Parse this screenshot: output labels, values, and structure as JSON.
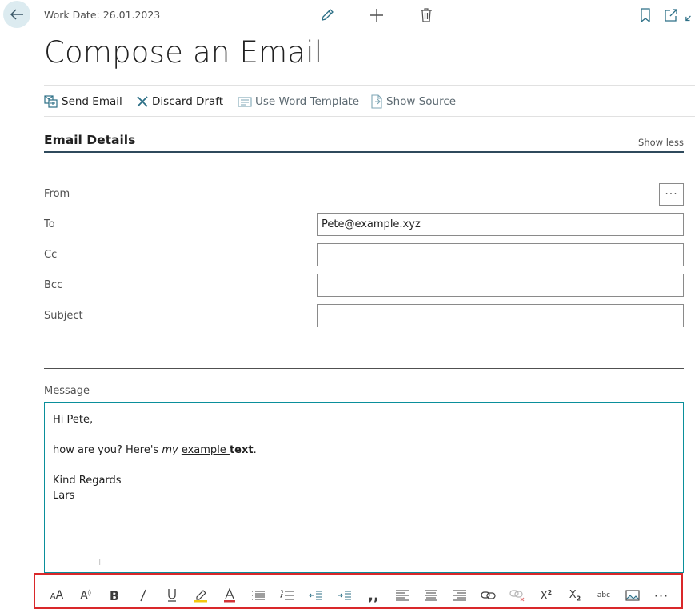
{
  "header": {
    "work_date": "Work Date: 26.01.2023",
    "title": "Compose an Email"
  },
  "actions": {
    "send": "Send Email",
    "discard": "Discard Draft",
    "word_template": "Use Word Template",
    "show_source": "Show Source"
  },
  "section": {
    "title": "Email Details",
    "toggle": "Show less"
  },
  "fields": {
    "from": {
      "label": "From",
      "value": ""
    },
    "to": {
      "label": "To",
      "value": "Pete@example.xyz"
    },
    "cc": {
      "label": "Cc",
      "value": ""
    },
    "bcc": {
      "label": "Bcc",
      "value": ""
    },
    "subject": {
      "label": "Subject",
      "value": ""
    }
  },
  "message": {
    "label": "Message",
    "greeting": "Hi Pete,",
    "line_start": "how are you? Here's ",
    "italic_word": "my",
    "space": " ",
    "underlined_word": "example ",
    "bold_word": "text",
    "line_end": ".",
    "closing": "Kind Regards",
    "signature": "Lars"
  },
  "toolbar_icons": [
    "font-size-icon",
    "font-grow-icon",
    "bold-icon",
    "italic-icon",
    "underline-icon",
    "highlight-icon",
    "font-color-icon",
    "bullet-list-icon",
    "numbered-list-icon",
    "decrease-indent-icon",
    "increase-indent-icon",
    "quote-icon",
    "align-left-icon",
    "align-center-icon",
    "align-right-icon",
    "link-icon",
    "unlink-icon",
    "superscript-icon",
    "subscript-icon",
    "strikethrough-icon",
    "image-icon",
    "more-icon"
  ],
  "colors": {
    "accent": "#0a8f9b",
    "highlight_marker": "#f2c811",
    "font_color_marker": "#d13438",
    "toolbar_frame": "#d9282a",
    "section_underline": "#2f4a5c"
  }
}
